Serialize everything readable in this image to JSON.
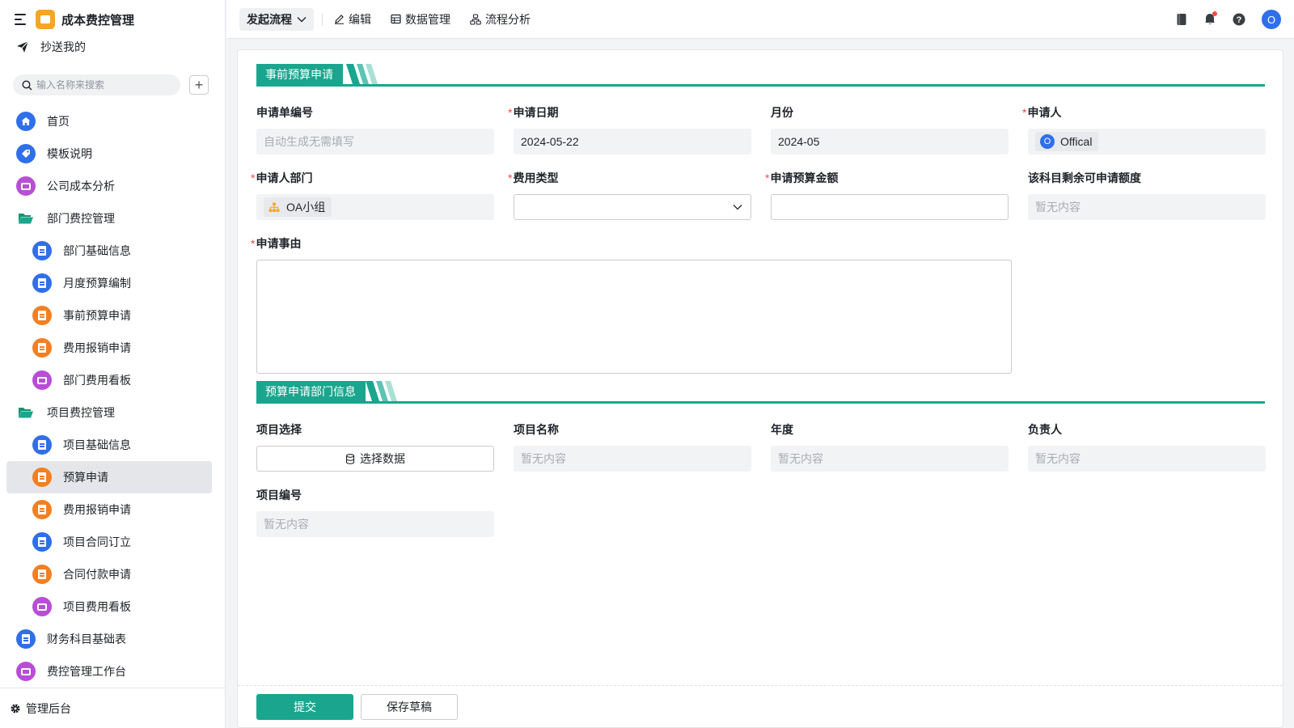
{
  "app": {
    "title": "成本费控管理",
    "accent": "#1aa68e"
  },
  "sidebar": {
    "cc_label": "抄送我的",
    "search_placeholder": "输入名称来搜索",
    "items": [
      {
        "label": "首页",
        "icon": "home-icon"
      },
      {
        "label": "模板说明",
        "icon": "tag-icon"
      },
      {
        "label": "公司成本分析",
        "icon": "dashboard-icon"
      },
      {
        "label": "部门费控管理",
        "icon": "folder-icon"
      },
      {
        "label": "部门基础信息",
        "icon": "doc-icon"
      },
      {
        "label": "月度预算编制",
        "icon": "doc-icon"
      },
      {
        "label": "事前预算申请",
        "icon": "form-icon"
      },
      {
        "label": "费用报销申请",
        "icon": "form-icon"
      },
      {
        "label": "部门费用看板",
        "icon": "dashboard-icon"
      },
      {
        "label": "项目费控管理",
        "icon": "folder-icon"
      },
      {
        "label": "项目基础信息",
        "icon": "doc-icon"
      },
      {
        "label": "预算申请",
        "icon": "form-icon",
        "active": true
      },
      {
        "label": "费用报销申请",
        "icon": "form-icon"
      },
      {
        "label": "项目合同订立",
        "icon": "doc-icon"
      },
      {
        "label": "合同付款申请",
        "icon": "form-icon"
      },
      {
        "label": "项目费用看板",
        "icon": "dashboard-icon"
      },
      {
        "label": "财务科目基础表",
        "icon": "doc-icon"
      },
      {
        "label": "费控管理工作台",
        "icon": "dashboard-icon"
      }
    ],
    "footer_label": "管理后台"
  },
  "topbar": {
    "launch_label": "发起流程",
    "edit_label": "编辑",
    "data_label": "数据管理",
    "flow_label": "流程分析",
    "avatar_letter": "O"
  },
  "form": {
    "section1_title": "事前预算申请",
    "apply_no": {
      "label": "申请单编号",
      "placeholder": "自动生成无需填写"
    },
    "apply_date": {
      "label": "申请日期",
      "value": "2024-05-22"
    },
    "month": {
      "label": "月份",
      "value": "2024-05"
    },
    "applicant": {
      "label": "申请人",
      "value": "Offical",
      "avatar": "O"
    },
    "dept": {
      "label": "申请人部门",
      "value": "OA小组"
    },
    "fee_type": {
      "label": "费用类型",
      "value": ""
    },
    "amount": {
      "label": "申请预算金额",
      "value": ""
    },
    "remaining": {
      "label": "该科目剩余可申请额度",
      "placeholder": "暂无内容"
    },
    "reason": {
      "label": "申请事由",
      "value": ""
    },
    "section2_title": "预算申请部门信息",
    "project_select": {
      "label": "项目选择",
      "button": "选择数据"
    },
    "project_name": {
      "label": "项目名称",
      "placeholder": "暂无内容"
    },
    "year": {
      "label": "年度",
      "placeholder": "暂无内容"
    },
    "owner": {
      "label": "负责人",
      "placeholder": "暂无内容"
    },
    "project_no": {
      "label": "项目编号",
      "placeholder": "暂无内容"
    }
  },
  "footer": {
    "submit_label": "提交",
    "draft_label": "保存草稿"
  }
}
